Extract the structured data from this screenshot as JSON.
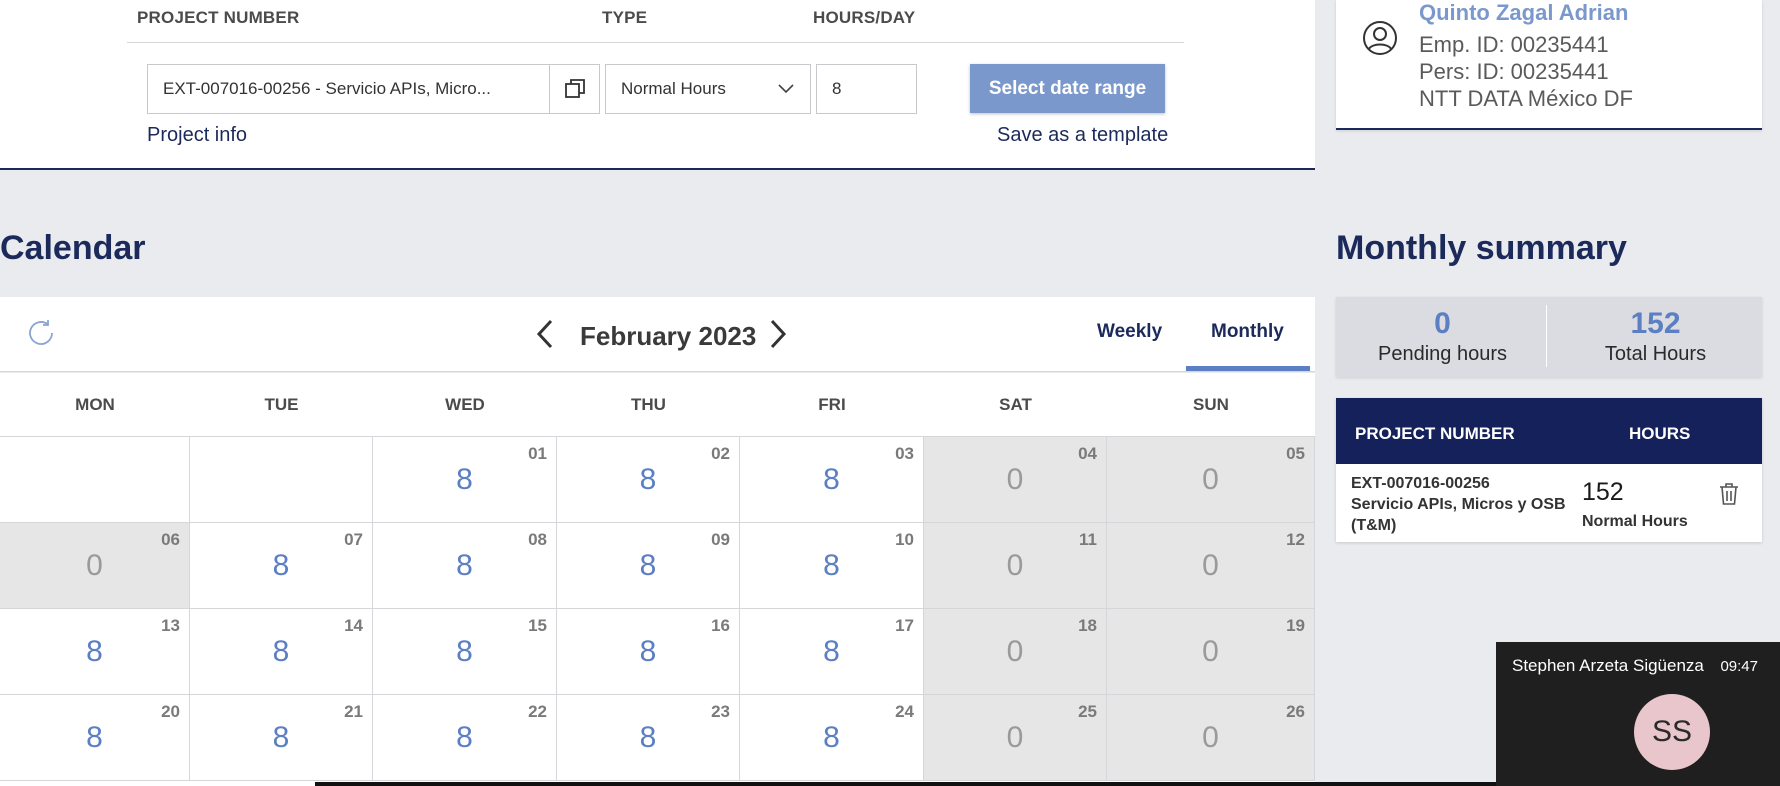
{
  "form": {
    "col_project": "PROJECT NUMBER",
    "col_type": "TYPE",
    "col_hours": "HOURS/DAY",
    "project_value": "EXT-007016-00256 - Servicio APIs, Micro...",
    "type_value": "Normal Hours",
    "hours_value": "8",
    "select_range": "Select date range",
    "project_info": "Project info",
    "save_template": "Save as a template"
  },
  "employee": {
    "name": "Quinto Zagal Adrian",
    "emp_id": "Emp. ID: 00235441",
    "pers_id": "Pers: ID: 00235441",
    "org": "NTT DATA México DF"
  },
  "calendar": {
    "title": "Calendar",
    "month": "February 2023",
    "tabs": [
      "Weekly",
      "Monthly"
    ],
    "active_tab": "Monthly",
    "days": [
      "MON",
      "TUE",
      "WED",
      "THU",
      "FRI",
      "SAT",
      "SUN"
    ],
    "weeks": [
      [
        null,
        null,
        {
          "d": "01",
          "h": "8"
        },
        {
          "d": "02",
          "h": "8"
        },
        {
          "d": "03",
          "h": "8"
        },
        {
          "d": "04",
          "h": "0"
        },
        {
          "d": "05",
          "h": "0"
        }
      ],
      [
        {
          "d": "06",
          "h": "0",
          "muted": true
        },
        {
          "d": "07",
          "h": "8"
        },
        {
          "d": "08",
          "h": "8"
        },
        {
          "d": "09",
          "h": "8"
        },
        {
          "d": "10",
          "h": "8"
        },
        {
          "d": "11",
          "h": "0"
        },
        {
          "d": "12",
          "h": "0"
        }
      ],
      [
        {
          "d": "13",
          "h": "8"
        },
        {
          "d": "14",
          "h": "8"
        },
        {
          "d": "15",
          "h": "8"
        },
        {
          "d": "16",
          "h": "8"
        },
        {
          "d": "17",
          "h": "8"
        },
        {
          "d": "18",
          "h": "0"
        },
        {
          "d": "19",
          "h": "0"
        }
      ],
      [
        {
          "d": "20",
          "h": "8"
        },
        {
          "d": "21",
          "h": "8"
        },
        {
          "d": "22",
          "h": "8"
        },
        {
          "d": "23",
          "h": "8"
        },
        {
          "d": "24",
          "h": "8"
        },
        {
          "d": "25",
          "h": "0"
        },
        {
          "d": "26",
          "h": "0"
        }
      ]
    ]
  },
  "summary": {
    "title": "Monthly summary",
    "pending_value": "0",
    "pending_label": "Pending hours",
    "total_value": "152",
    "total_label": "Total Hours",
    "th_project": "PROJECT NUMBER",
    "th_hours": "HOURS",
    "row_project": "EXT-007016-00256\nServicio APIs, Micros y OSB (T&M)",
    "row_hours": "152",
    "row_type": "Normal Hours"
  },
  "call": {
    "name": "Stephen Arzeta Sigüenza",
    "time": "09:47",
    "initials": "SS"
  },
  "colors": {
    "navy": "#1b2a5b",
    "accent": "#5b7fc2",
    "button": "#7b98cc"
  }
}
